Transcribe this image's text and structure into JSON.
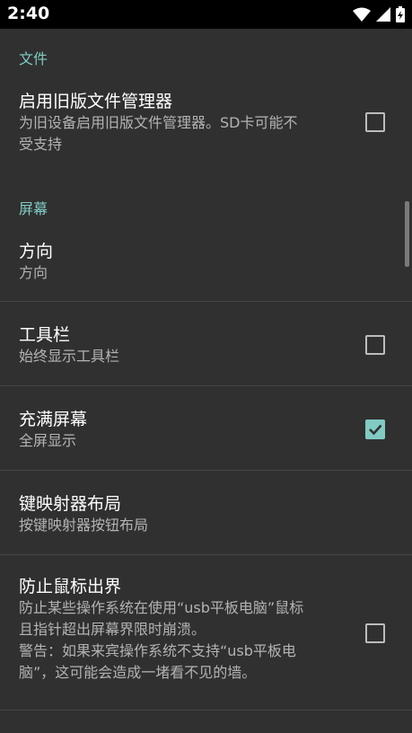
{
  "status_bar": {
    "time": "2:40",
    "icons": [
      "wifi-icon",
      "signal-icon",
      "battery-charging-icon"
    ]
  },
  "sections": {
    "files": {
      "header": "文件"
    },
    "screen": {
      "header": "屏幕"
    }
  },
  "prefs": {
    "legacy_file_manager": {
      "title": "启用旧版文件管理器",
      "summary_line1": "为旧设备启用旧版文件管理器。SD卡可能不",
      "summary_line2": "受支持",
      "checked": false
    },
    "orientation": {
      "title": "方向",
      "summary": "方向"
    },
    "toolbar": {
      "title": "工具栏",
      "summary": "始终显示工具栏",
      "checked": false
    },
    "fullscreen": {
      "title": "充满屏幕",
      "summary": "全屏显示",
      "checked": true
    },
    "keymapper_layout": {
      "title": "键映射器布局",
      "summary": "按键映射器按钮布局"
    },
    "prevent_mouse": {
      "title": "防止鼠标出界",
      "summary_line1": "防止某些操作系统在使用“usb平板电脑”鼠标",
      "summary_line2": "且指针超出屏幕界限时崩溃。",
      "summary_line3": "警告：如果来宾操作系统不支持“usb平板电",
      "summary_line4": "脑”，这可能会造成一堵看不见的墙。",
      "checked": false
    }
  },
  "colors": {
    "accent": "#80cbc4",
    "background": "#303030",
    "statusbar": "#000000"
  }
}
